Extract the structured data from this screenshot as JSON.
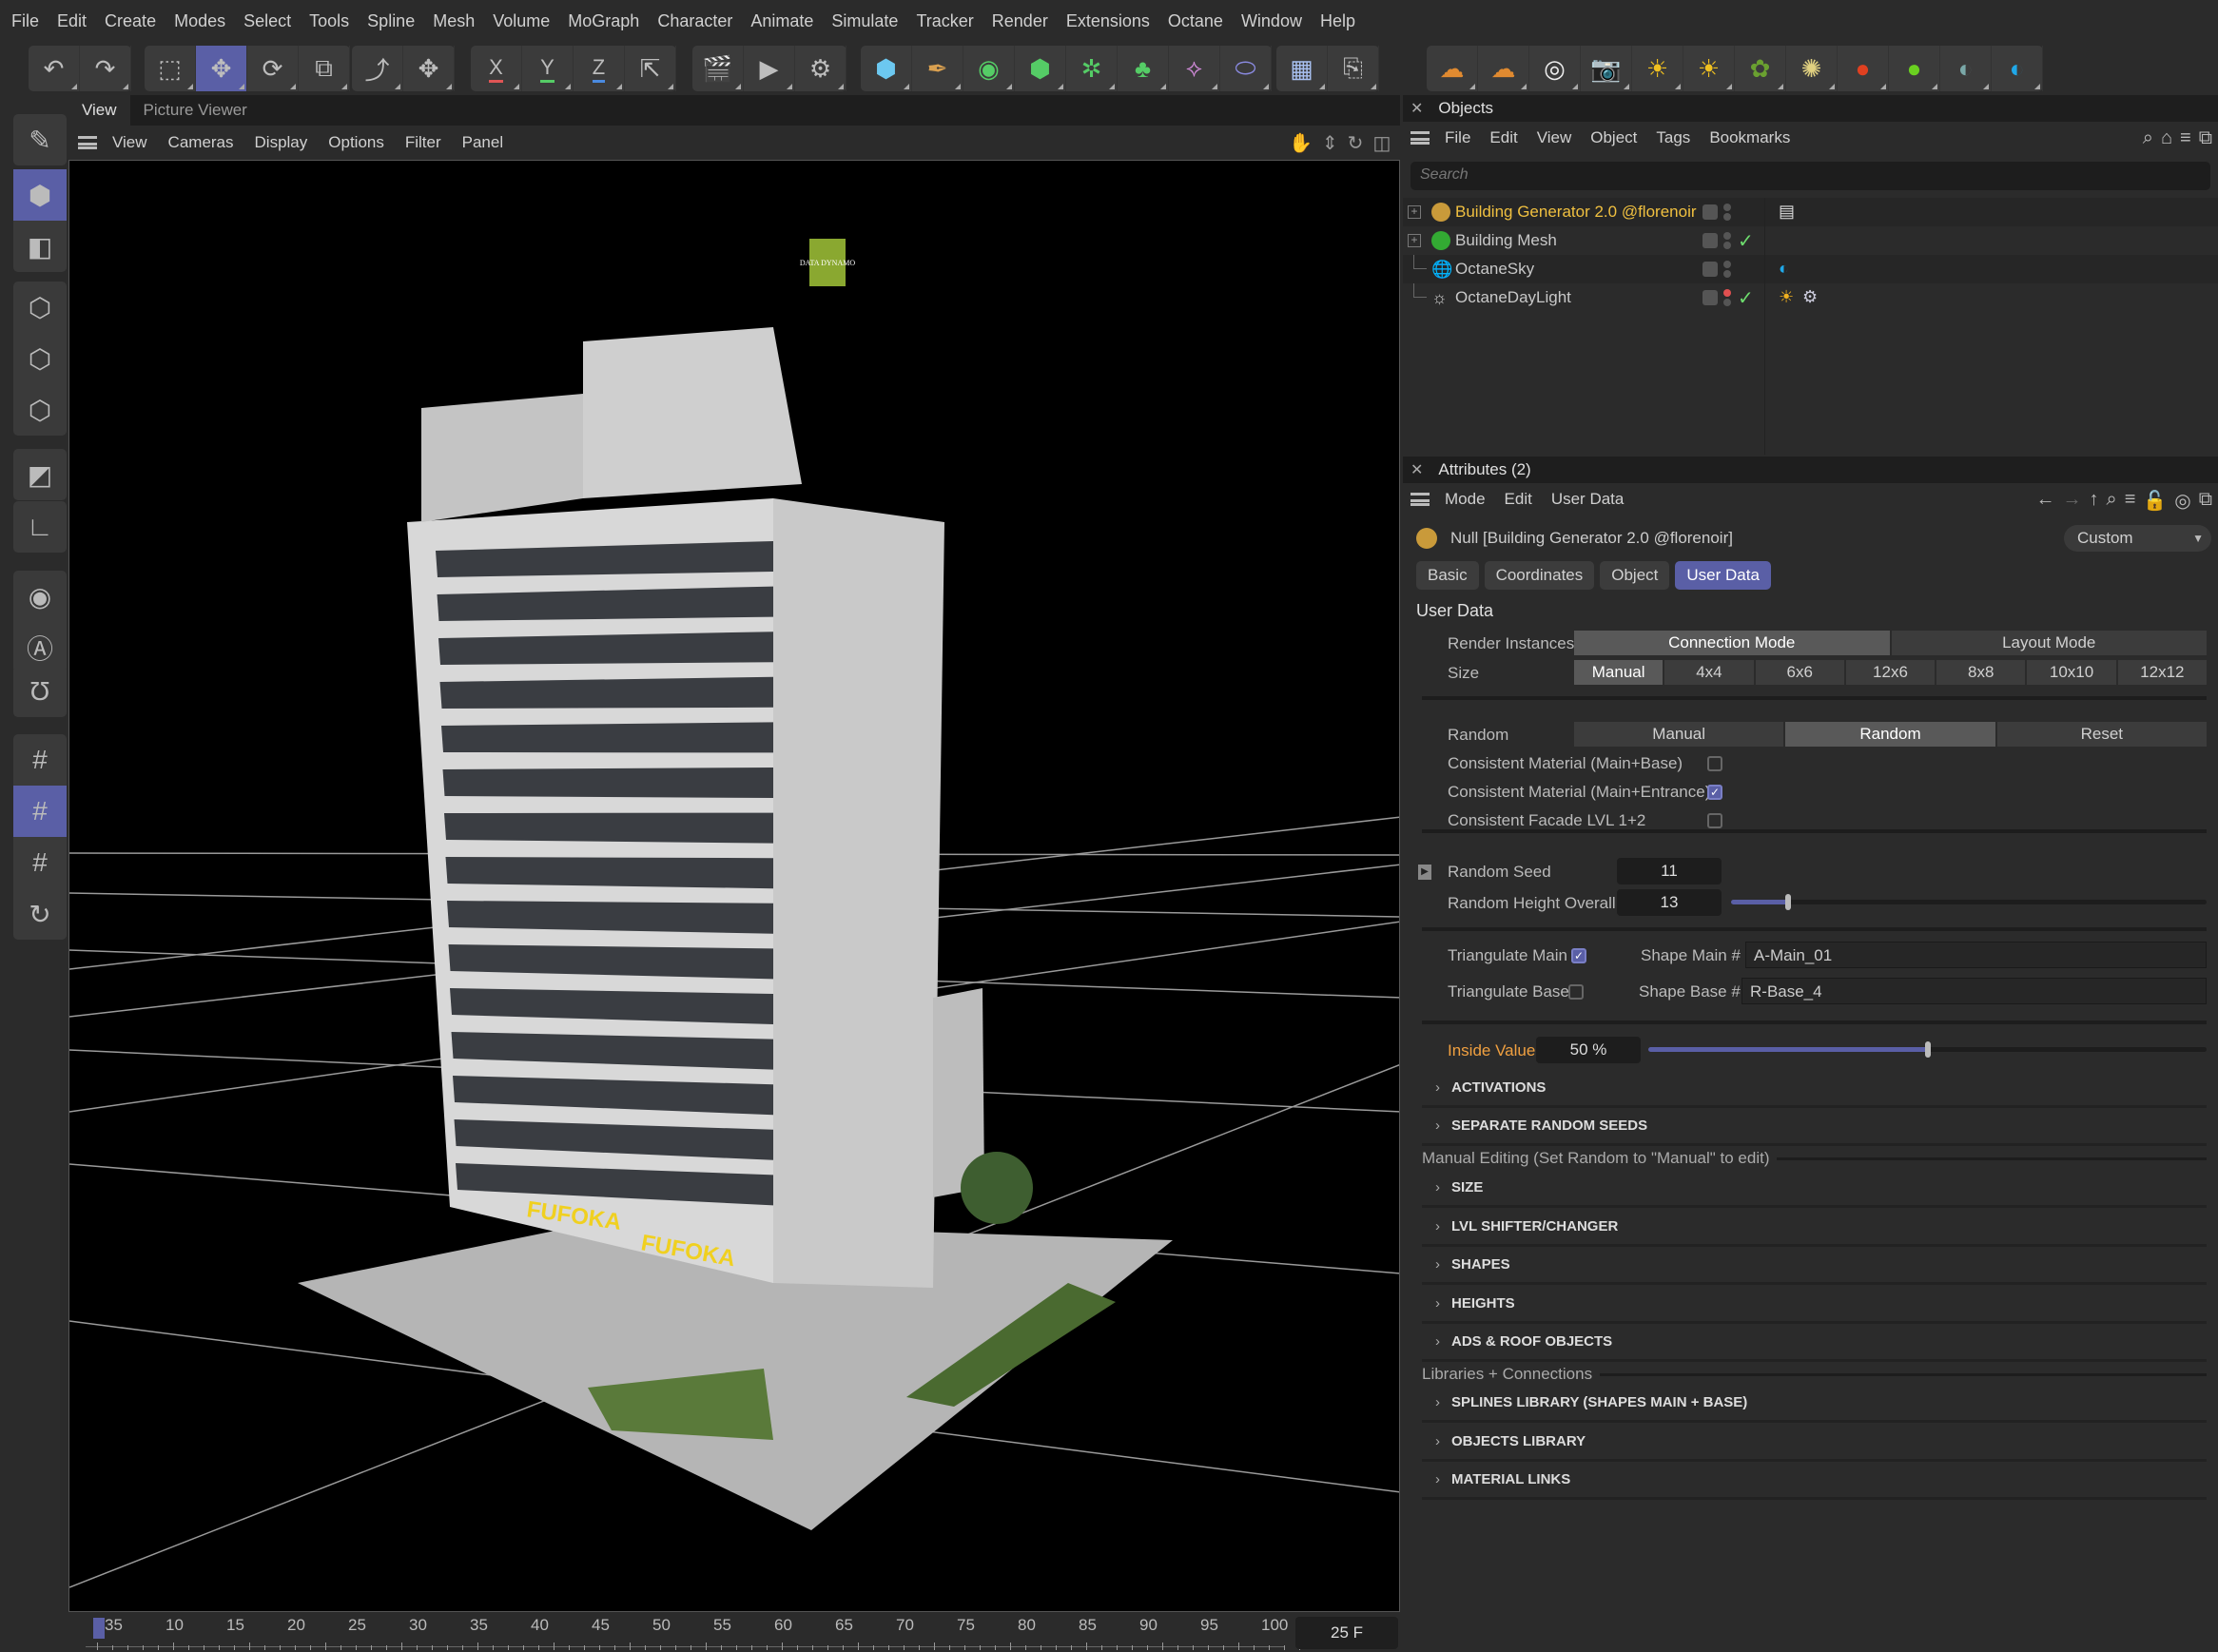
{
  "menubar": {
    "items": [
      "File",
      "Edit",
      "Create",
      "Modes",
      "Select",
      "Tools",
      "Spline",
      "Mesh",
      "Volume",
      "MoGraph",
      "Character",
      "Animate",
      "Simulate",
      "Tracker",
      "Render",
      "Extensions",
      "Octane",
      "Window",
      "Help"
    ]
  },
  "toolbar": {
    "history": [
      {
        "icon": "undo-icon",
        "glyph": "↶"
      },
      {
        "icon": "redo-icon",
        "glyph": "↷"
      }
    ],
    "transform": [
      {
        "icon": "live-selection-icon",
        "glyph": "⬚"
      },
      {
        "icon": "move-icon",
        "glyph": "✥",
        "active": true
      },
      {
        "icon": "rotate-icon",
        "glyph": "⟳"
      },
      {
        "icon": "scale-icon",
        "glyph": "⧉"
      }
    ],
    "axes": [
      {
        "icon": "x-axis-icon",
        "glyph": "X",
        "color": "#e05555"
      },
      {
        "icon": "y-axis-icon",
        "glyph": "Y",
        "color": "#55cc66"
      },
      {
        "icon": "z-axis-icon",
        "glyph": "Z",
        "color": "#4a8ae0"
      },
      {
        "icon": "coordinate-system-icon",
        "glyph": "⇱"
      }
    ],
    "render": [
      {
        "icon": "render-view-icon",
        "glyph": "🎬"
      },
      {
        "icon": "render-to-picture-viewer-icon",
        "glyph": "▶"
      },
      {
        "icon": "render-settings-icon",
        "glyph": "⚙"
      }
    ],
    "create": [
      {
        "icon": "cube-icon",
        "glyph": "⬢",
        "color": "#6cc8f0"
      },
      {
        "icon": "pen-spline-icon",
        "glyph": "✒",
        "color": "#d9a050"
      },
      {
        "icon": "subdivision-icon",
        "glyph": "◉",
        "color": "#55cc66"
      },
      {
        "icon": "extrude-icon",
        "glyph": "⬢",
        "color": "#55cc66"
      },
      {
        "icon": "cloner-icon",
        "glyph": "✲",
        "color": "#55cc66"
      },
      {
        "icon": "mograph-icon",
        "glyph": "♣",
        "color": "#55cc66"
      },
      {
        "icon": "deformer-icon",
        "glyph": "⟡",
        "color": "#d08ad8"
      },
      {
        "icon": "field-icon",
        "glyph": "⬭",
        "color": "#8a8ae0"
      }
    ],
    "scene": [
      {
        "icon": "floor-icon",
        "glyph": "▦",
        "color": "#a8c0f0"
      },
      {
        "icon": "camera-st-icon",
        "glyph": "⎘",
        "color": "#bbb"
      }
    ],
    "octane": [
      {
        "icon": "explosion-icon",
        "glyph": "☁",
        "color": "#e08a30"
      },
      {
        "icon": "explosion-2-icon",
        "glyph": "☁",
        "color": "#e08a30"
      },
      {
        "icon": "target-icon",
        "glyph": "◎",
        "color": "#eee"
      },
      {
        "icon": "octane-camera-icon",
        "glyph": "📷",
        "color": "#e02020"
      },
      {
        "icon": "sun-icon",
        "glyph": "☀",
        "color": "#f0c020"
      },
      {
        "icon": "sun-2-icon",
        "glyph": "☀",
        "color": "#f0c020"
      },
      {
        "icon": "scatter-icon",
        "glyph": "✿",
        "color": "#6aa030"
      },
      {
        "icon": "light-rays-icon",
        "glyph": "✺",
        "color": "#e0d080"
      },
      {
        "icon": "octane-render-icon",
        "glyph": "●",
        "color": "#e04020"
      },
      {
        "icon": "octane-live-viewer-icon",
        "glyph": "●",
        "color": "#6ad020"
      },
      {
        "icon": "octane-texture-env-icon",
        "glyph": "◐",
        "color": "#7aa8a8"
      },
      {
        "icon": "octane-sky-icon",
        "glyph": "◐",
        "color": "#20a8e8"
      }
    ]
  },
  "lefttools": [
    {
      "icon": "make-editable-icon",
      "glyph": "✎"
    },
    {
      "icon": "model-mode-icon",
      "glyph": "⬢",
      "active": true
    },
    {
      "icon": "texture-mode-icon",
      "glyph": "◧"
    },
    {
      "icon": "points-mode-icon",
      "glyph": "⬡"
    },
    {
      "icon": "edges-mode-icon",
      "glyph": "⬡"
    },
    {
      "icon": "polygons-mode-icon",
      "glyph": "⬡"
    },
    {
      "icon": "uv-mode-icon",
      "glyph": "◩"
    },
    {
      "icon": "axis-mode-icon",
      "glyph": "∟"
    },
    {
      "icon": "solo-icon",
      "glyph": "◉"
    },
    {
      "icon": "viewport-solo-icon",
      "glyph": "Ⓐ"
    },
    {
      "icon": "snap-icon",
      "glyph": "Ʊ"
    },
    {
      "icon": "workplane-icon",
      "glyph": "#"
    },
    {
      "icon": "locked-workplane-icon",
      "glyph": "#",
      "active": true
    },
    {
      "icon": "workplane-auto-icon",
      "glyph": "#"
    },
    {
      "icon": "reset-icon",
      "glyph": "↻"
    }
  ],
  "viewtabs": [
    {
      "label": "View",
      "active": true
    },
    {
      "label": "Picture Viewer",
      "active": false
    }
  ],
  "viewmenu": [
    "View",
    "Cameras",
    "Display",
    "Options",
    "Filter",
    "Panel"
  ],
  "timeline": {
    "ticks": [
      "35",
      "10",
      "15",
      "20",
      "25",
      "30",
      "35",
      "40",
      "45",
      "50",
      "55",
      "60",
      "65",
      "70",
      "75",
      "80",
      "85",
      "90",
      "95",
      "100"
    ],
    "current_frame": "25 F"
  },
  "objects": {
    "title": "Objects",
    "menu": [
      "File",
      "Edit",
      "View",
      "Object",
      "Tags",
      "Bookmarks"
    ],
    "search_placeholder": "Search",
    "rows": [
      {
        "name": "Building Generator 2.0 @florenoir",
        "color": "#c99a3a",
        "highlight": true,
        "expand": true,
        "check": false
      },
      {
        "name": "Building Mesh",
        "color": "#33aa33",
        "highlight": false,
        "expand": true,
        "check": true
      },
      {
        "name": "OctaneSky",
        "icon": "globe-icon",
        "highlight": false,
        "expand": false,
        "check": false
      },
      {
        "name": "OctaneDayLight",
        "icon": "daylight-icon",
        "highlight": false,
        "expand": false,
        "check": true
      }
    ]
  },
  "attributes": {
    "title": "Attributes (2)",
    "menu": [
      "Mode",
      "Edit",
      "User Data"
    ],
    "object_name": "Null [Building Generator 2.0 @florenoir]",
    "mode_select": "Custom",
    "tabs": [
      {
        "label": "Basic"
      },
      {
        "label": "Coordinates"
      },
      {
        "label": "Object"
      },
      {
        "label": "User Data",
        "active": true
      }
    ],
    "section_title": "User Data",
    "render_instances": {
      "label": "Render Instances",
      "options": [
        "Connection Mode",
        "Layout Mode"
      ],
      "selected": 0
    },
    "size": {
      "label": "Size",
      "options": [
        "Manual",
        "4x4",
        "6x6",
        "12x6",
        "8x8",
        "10x10",
        "12x12"
      ],
      "selected": 0
    },
    "random": {
      "label": "Random",
      "options": [
        "Manual",
        "Random",
        "Reset"
      ],
      "selected": 1
    },
    "checks": [
      {
        "label": "Consistent Material (Main+Base)",
        "checked": false
      },
      {
        "label": "Consistent Material (Main+Entrance)",
        "checked": true
      },
      {
        "label": "Consistent Facade LVL 1+2",
        "checked": false
      }
    ],
    "random_seed": {
      "label": "Random Seed",
      "value": "11"
    },
    "random_height": {
      "label": "Random Height Overall",
      "value": "13",
      "slider_fraction": 0.12
    },
    "triangulate_main": {
      "label": "Triangulate Main",
      "checked": true
    },
    "triangulate_base": {
      "label": "Triangulate Base",
      "checked": false
    },
    "shape_main": {
      "label": "Shape Main #",
      "value": "A-Main_01"
    },
    "shape_base": {
      "label": "Shape Base #",
      "value": "R-Base_4"
    },
    "inside_value": {
      "label": "Inside Value",
      "value": "50 %",
      "slider_fraction": 0.5,
      "color": "#f0a040"
    },
    "groups_a": [
      "ACTIVATIONS",
      "SEPARATE RANDOM SEEDS"
    ],
    "manual_editing_label": "Manual Editing (Set Random to \"Manual\" to edit)",
    "groups_b": [
      "SIZE",
      "LVL SHIFTER/CHANGER",
      "SHAPES",
      "HEIGHTS",
      "ADS & ROOF OBJECTS"
    ],
    "libraries_label": "Libraries + Connections",
    "groups_c": [
      "SPLINES LIBRARY (SHAPES MAIN + BASE)",
      "OBJECTS LIBRARY",
      "MATERIAL LINKS"
    ]
  },
  "viewport": {
    "signs": [
      "FUFOKA",
      "FUFOKA"
    ],
    "rooftop_sign": "DATA DYNAMO"
  },
  "colors": {
    "accent": "#5a5fa6",
    "highlight_text": "#f0c040",
    "check": "#6ddc6d"
  }
}
